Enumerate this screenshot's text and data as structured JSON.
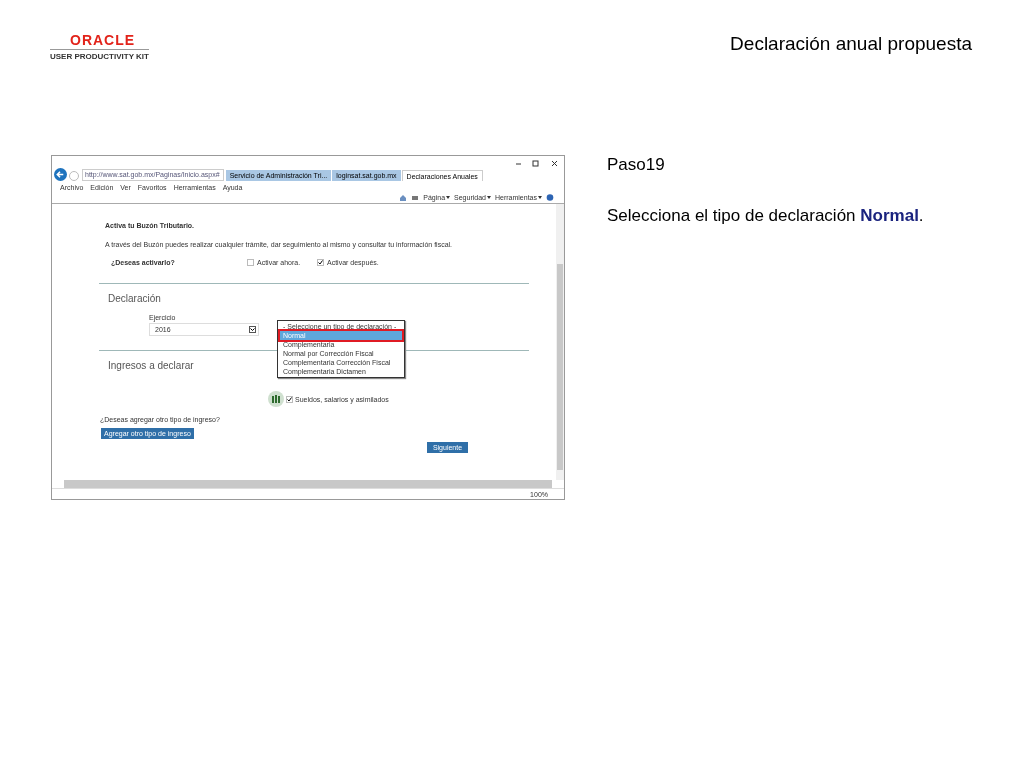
{
  "logo": {
    "brand": "ORACLE",
    "product": "USER PRODUCTIVITY KIT"
  },
  "slide_title": "Declaración anual propuesta",
  "browser": {
    "url": "http://www.sat.gob.mx/Paginas/Inicio.aspx#",
    "tabs": [
      {
        "label": "Servicio de Administración Tri...",
        "selected": false
      },
      {
        "label": "loginsat.sat.gob.mx",
        "selected": false
      },
      {
        "label": "Declaraciones Anuales",
        "selected": true
      }
    ],
    "menu": [
      "Archivo",
      "Edición",
      "Ver",
      "Favoritos",
      "Herramientas",
      "Ayuda"
    ],
    "toolbar": [
      "Página",
      "Seguridad",
      "Herramientas"
    ],
    "zoom": "100%"
  },
  "page": {
    "buzon_title": "Activa tu Buzón Tributario.",
    "buzon_text": "A través del Buzón puedes realizar cualquier trámite, dar seguimiento al mismo y consultar tu información fiscal.",
    "question": "¿Deseas activarlo?",
    "options": [
      {
        "label": "Activar ahora.",
        "checked": false
      },
      {
        "label": "Activar después.",
        "checked": true
      }
    ],
    "section1": "Declaración",
    "field_label": "Ejercicio",
    "field_value": "2016",
    "dropdown": [
      {
        "label": "- Seleccione un tipo de declaración -",
        "selected": false
      },
      {
        "label": "Normal",
        "selected": true
      },
      {
        "label": "Complementaria",
        "selected": false
      },
      {
        "label": "Normal por Corrección Fiscal",
        "selected": false
      },
      {
        "label": "Complementaria Corrección Fiscal",
        "selected": false
      },
      {
        "label": "Complementaria Dictamen",
        "selected": false
      }
    ],
    "section2": "Ingresos a declarar",
    "income": {
      "label": "Sueldos, salarios y asimilados",
      "checked": true
    },
    "add_question": "¿Deseas agregar otro tipo de ingreso?",
    "add_button": "Agregar otro tipo de ingreso",
    "next_button": "Siguiente"
  },
  "step": {
    "label": "Paso19",
    "instruction": "Selecciona el tipo de declaración **Normal**."
  }
}
